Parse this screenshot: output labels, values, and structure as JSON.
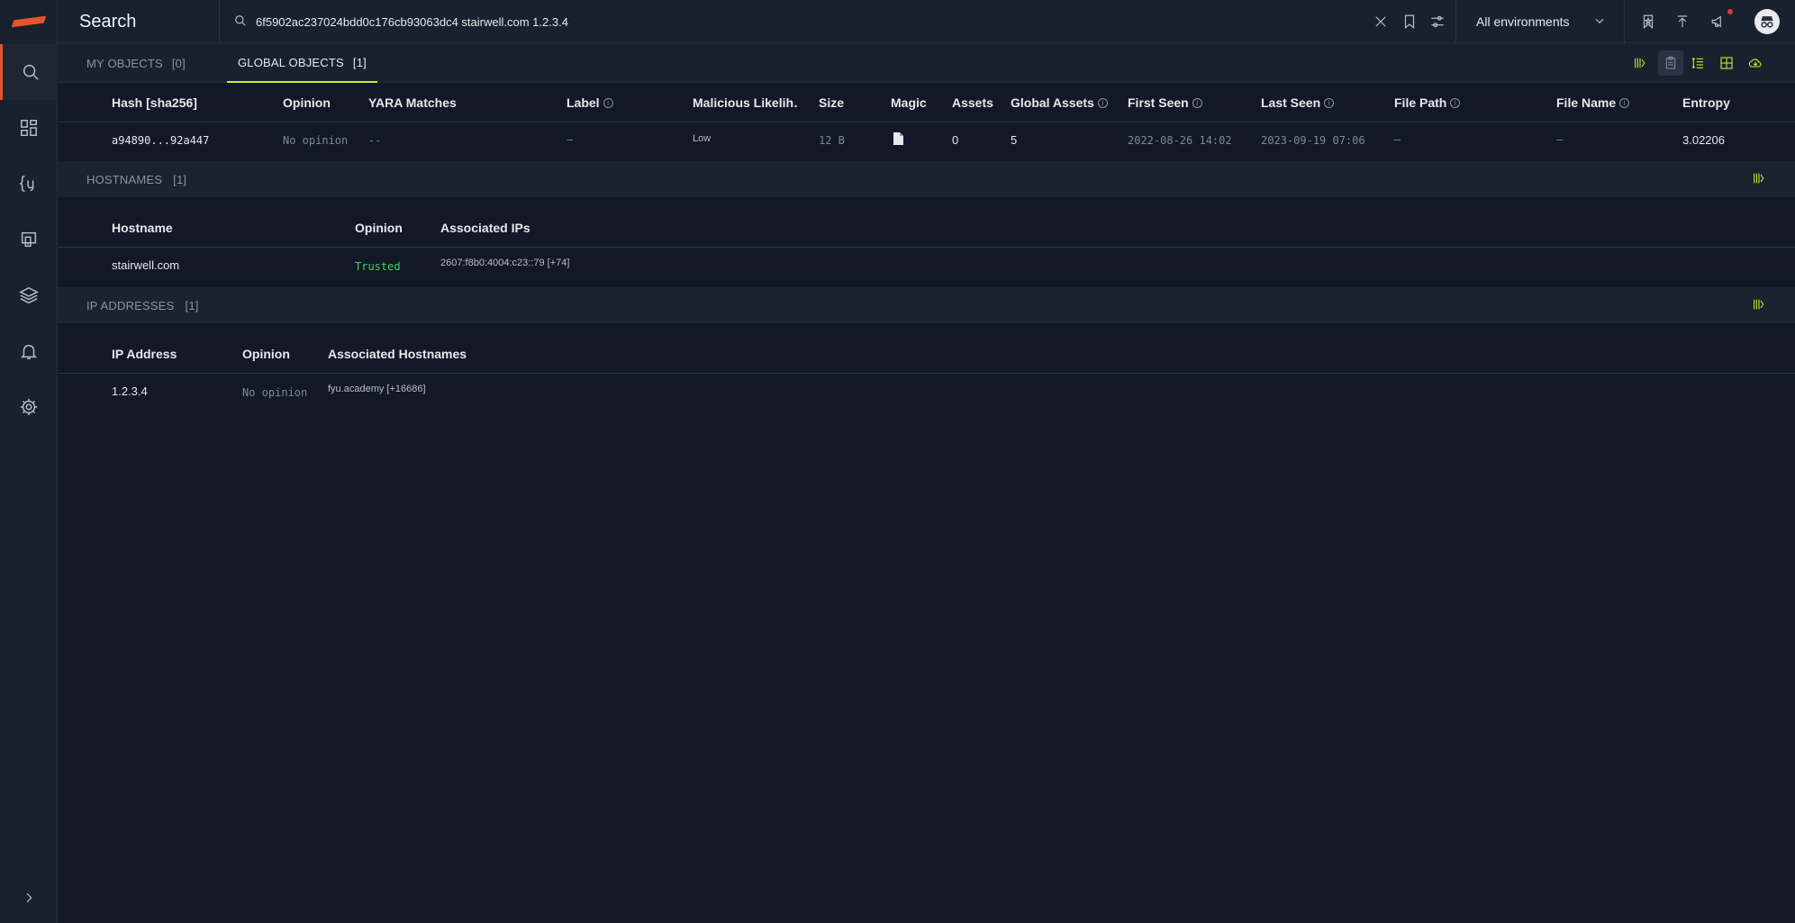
{
  "app": {
    "title": "Search"
  },
  "search": {
    "value": "6f5902ac237024bdd0c176cb93063dc4 stairwell.com 1.2.3.4",
    "placeholder": ""
  },
  "environment": {
    "selected": "All environments"
  },
  "colors": {
    "accent": "#c6f432",
    "brand": "#e8532d",
    "trusted": "#3ad36a",
    "notification": "#e5352b"
  },
  "tabs": [
    {
      "label": "MY OBJECTS",
      "count": "[0]",
      "active": false
    },
    {
      "label": "GLOBAL OBJECTS",
      "count": "[1]",
      "active": true
    }
  ],
  "objects": {
    "columns": [
      "Hash [sha256]",
      "Opinion",
      "YARA Matches",
      "Label",
      "Malicious Likelih…",
      "Size",
      "Magic",
      "Assets",
      "Global Assets",
      "First Seen",
      "Last Seen",
      "File Path",
      "File Name",
      "Entropy"
    ],
    "rows": [
      {
        "hash": "a94890...92a447",
        "opinion": "No opinion",
        "yara": "--",
        "label": "–",
        "malicious": "Low",
        "size": "12 B",
        "magic": "file-icon",
        "assets": "0",
        "global_assets": "5",
        "first_seen": "2022-08-26 14:02:",
        "last_seen": "2023-09-19 07:06:",
        "file_path": "–",
        "file_name": "–",
        "entropy": "3.02206"
      }
    ]
  },
  "hostnames": {
    "title": "HOSTNAMES",
    "count": "[1]",
    "columns": [
      "Hostname",
      "Opinion",
      "Associated IPs"
    ],
    "rows": [
      {
        "hostname": "stairwell.com",
        "opinion": "Trusted",
        "ips": "2607:f8b0:4004:c23::79 [+74]"
      }
    ]
  },
  "ip_addresses": {
    "title": "IP ADDRESSES",
    "count": "[1]",
    "columns": [
      "IP Address",
      "Opinion",
      "Associated Hostnames"
    ],
    "rows": [
      {
        "ip": "1.2.3.4",
        "opinion": "No opinion",
        "hostnames": "fyu.academy [+16686]"
      }
    ]
  },
  "icons": {
    "sidebar": [
      "search-icon",
      "dashboard-icon",
      "yara-rules-icon",
      "assets-icon",
      "layers-icon",
      "bell-icon",
      "gear-icon"
    ],
    "topbar": [
      "close-icon",
      "bookmark-icon",
      "filter-sliders-icon",
      "bookmark-star-icon",
      "upload-icon",
      "megaphone-icon",
      "incognito-avatar-icon"
    ],
    "toolbar": [
      "columns-icon",
      "clipboard-icon",
      "row-density-icon",
      "grid-icon",
      "cloud-download-icon"
    ]
  }
}
